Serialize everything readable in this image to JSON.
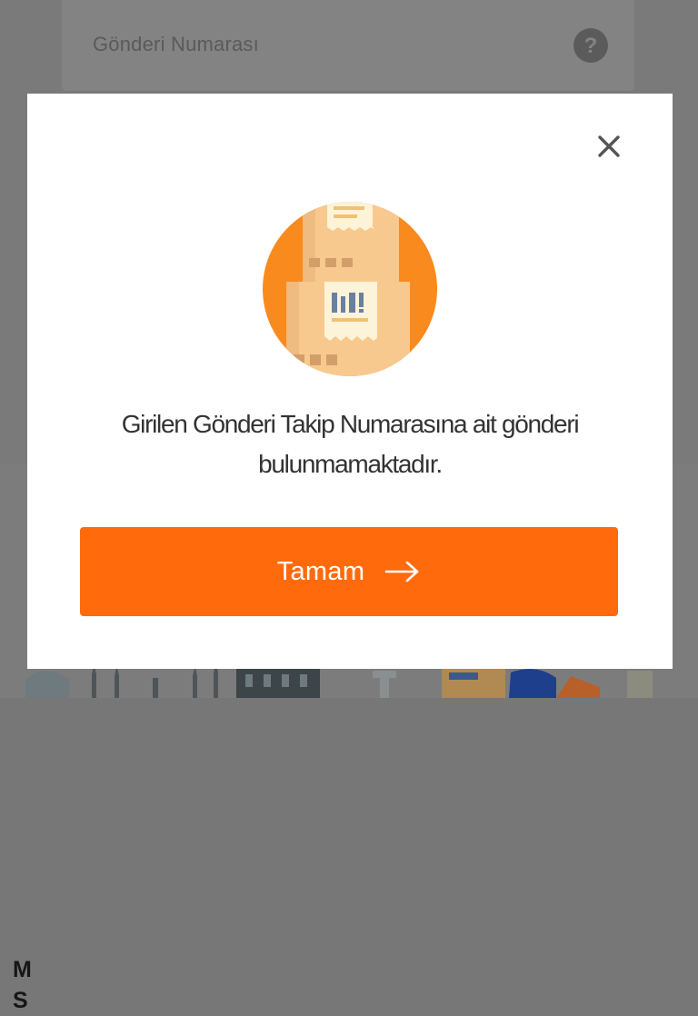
{
  "background": {
    "tracking_input": {
      "placeholder": "Gönderi Numarası",
      "help_icon": "question-circle-icon"
    },
    "side_text": "M\nS"
  },
  "modal": {
    "close_icon": "close-icon",
    "illustration_icon": "package-boxes-icon",
    "message": "Girilen Gönderi Takip Numarasına ait gönderi bulunmamaktadır.",
    "button": {
      "label": "Tamam",
      "icon": "arrow-right-icon"
    }
  },
  "colors": {
    "accent": "#ff6a0d",
    "overlay": "#777777",
    "modal_bg": "#ffffff",
    "text": "#333333"
  }
}
